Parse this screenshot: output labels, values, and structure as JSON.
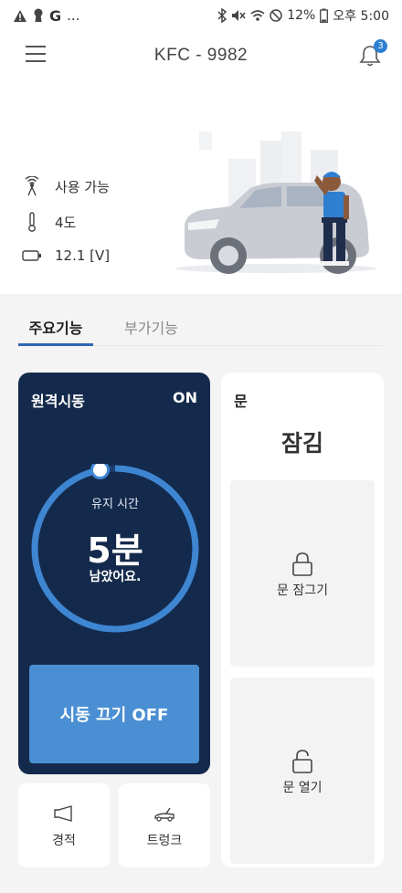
{
  "status_bar": {
    "left_icons": [
      "warning-icon",
      "keyhole-icon",
      "google-icon"
    ],
    "left_text": "G",
    "ellipsis": "...",
    "battery_text": "12%",
    "time": "오후 5:00"
  },
  "header": {
    "title": "KFC - 9982",
    "notification_count": "3"
  },
  "vehicle_info": {
    "connection": "사용 가능",
    "temperature": "4도",
    "voltage": "12.1 [V]"
  },
  "tabs": [
    {
      "label": "주요기능",
      "active": true
    },
    {
      "label": "부가기능",
      "active": false
    }
  ],
  "remote_start": {
    "title": "원격시동",
    "status": "ON",
    "timer_label": "유지 시간",
    "timer_value": "5분",
    "timer_suffix": "남았어요.",
    "progress_remaining": 0.97,
    "stop_button": "시동 끄기 OFF"
  },
  "door": {
    "title": "문",
    "state": "잠김",
    "lock_button": "문 잠그기",
    "unlock_button": "문 열기"
  },
  "extras": {
    "horn_label": "경적",
    "trunk_label": "트렁크"
  },
  "colors": {
    "remote_card_bg": "#142a4c",
    "accent_blue": "#4a8fd3",
    "ring_blue": "#3f86d2"
  }
}
